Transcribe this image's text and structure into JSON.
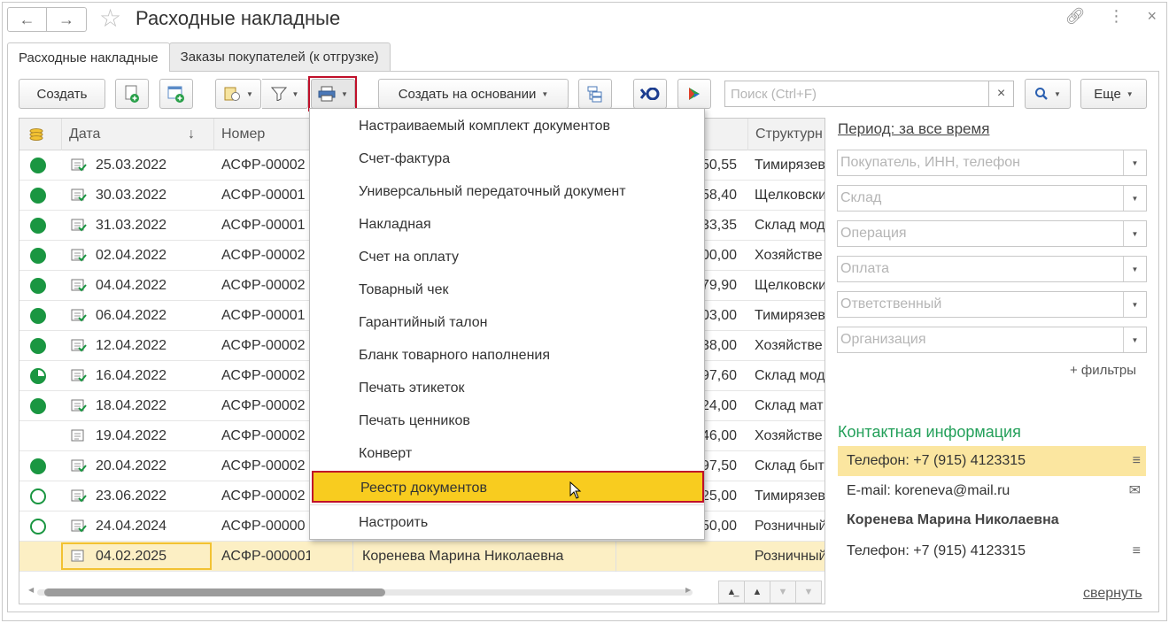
{
  "window": {
    "title": "Расходные накладные"
  },
  "tabs": [
    {
      "label": "Расходные накладные",
      "active": true
    },
    {
      "label": "Заказы покупателей (к отгрузке)",
      "active": false
    }
  ],
  "toolbar": {
    "create_label": "Создать",
    "create_based_label": "Создать на основании",
    "more_label": "Еще",
    "search_placeholder": "Поиск (Ctrl+F)",
    "search_clear": "×"
  },
  "table": {
    "headers": {
      "date": "Дата",
      "date_sort": "↓",
      "number": "Номер",
      "structure": "Структурн"
    },
    "rows": [
      {
        "status": "full",
        "date": "25.03.2022",
        "number": "АСФР-00002",
        "amount": "50,55",
        "structure": "Тимирязев"
      },
      {
        "status": "full",
        "date": "30.03.2022",
        "number": "АСФР-00001",
        "amount": "58,40",
        "structure": "Щелковски"
      },
      {
        "status": "full",
        "date": "31.03.2022",
        "number": "АСФР-00001",
        "amount": "33,35",
        "structure": "Склад мод"
      },
      {
        "status": "full",
        "date": "02.04.2022",
        "number": "АСФР-00002",
        "amount": "00,00",
        "structure": "Хозяйстве"
      },
      {
        "status": "full",
        "date": "04.04.2022",
        "number": "АСФР-00002",
        "amount": "79,90",
        "structure": "Щелковски"
      },
      {
        "status": "full",
        "date": "06.04.2022",
        "number": "АСФР-00001",
        "amount": "03,00",
        "structure": "Тимирязев"
      },
      {
        "status": "full",
        "date": "12.04.2022",
        "number": "АСФР-00002",
        "amount": "38,00",
        "structure": "Хозяйстве"
      },
      {
        "status": "part",
        "date": "16.04.2022",
        "number": "АСФР-00002",
        "amount": "97,60",
        "structure": "Склад мод"
      },
      {
        "status": "full",
        "date": "18.04.2022",
        "number": "АСФР-00002",
        "amount": "24,00",
        "structure": "Склад мат"
      },
      {
        "status": "none",
        "date": "19.04.2022",
        "number": "АСФР-00002",
        "amount": "46,00",
        "structure": "Хозяйстве"
      },
      {
        "status": "full",
        "date": "20.04.2022",
        "number": "АСФР-00002",
        "amount": "97,50",
        "structure": "Склад быт"
      },
      {
        "status": "ring",
        "date": "23.06.2022",
        "number": "АСФР-00002",
        "amount": "25,00",
        "structure": "Тимирязев"
      },
      {
        "status": "ring",
        "date": "24.04.2024",
        "number": "АСФР-00000",
        "amount": "50,00",
        "structure": "Розничный"
      },
      {
        "status": "none",
        "date": "04.02.2025",
        "number": "АСФР-000001",
        "client": "Коренева Марина Николаевна",
        "amount": "",
        "structure": "Розничный",
        "selected": true
      }
    ]
  },
  "print_menu": {
    "items": [
      "Настраиваемый комплект документов",
      "Счет-фактура",
      "Универсальный передаточный документ",
      "Накладная",
      "Счет на оплату",
      "Товарный чек",
      "Гарантийный талон",
      "Бланк товарного наполнения",
      "Печать этикеток",
      "Печать ценников",
      "Конверт",
      "Реестр документов"
    ],
    "highlighted_index": 11,
    "settings_label": "Настроить"
  },
  "filters": {
    "period_label": "Период: за все время",
    "fields": [
      "Покупатель, ИНН, телефон",
      "Склад",
      "Операция",
      "Оплата",
      "Ответственный",
      "Организация"
    ],
    "more_filters": "+ фильтры"
  },
  "contact": {
    "title": "Контактная информация",
    "phone1": "Телефон: +7 (915) 4123315",
    "email": "E-mail: koreneva@mail.ru",
    "name": "Коренева Марина Николаевна",
    "phone2": "Телефон: +7 (915) 4123315",
    "collapse_label": "свернуть"
  },
  "colors": {
    "status_green": "#1a9641",
    "menu_highlight": "#f8cc1f",
    "highlight_border": "#c0102a",
    "contact_title": "#24a05a"
  }
}
